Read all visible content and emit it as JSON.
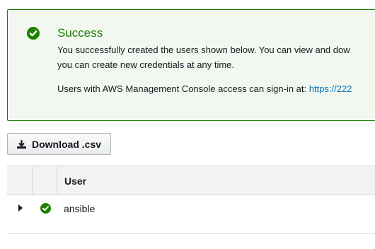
{
  "alert": {
    "title": "Success",
    "line1": "You successfully created the users shown below. You can view and dow",
    "line2": "you can create new credentials at any time.",
    "line3_prefix": "Users with AWS Management Console access can sign-in at: ",
    "signin_link": "https://222",
    "icon": "check-circle-icon",
    "color": "#1d8102"
  },
  "toolbar": {
    "download_label": "Download .csv",
    "download_icon": "download-icon"
  },
  "table": {
    "columns": [
      "User"
    ],
    "rows": [
      {
        "status_icon": "check-circle-icon",
        "user": "ansible"
      }
    ]
  }
}
